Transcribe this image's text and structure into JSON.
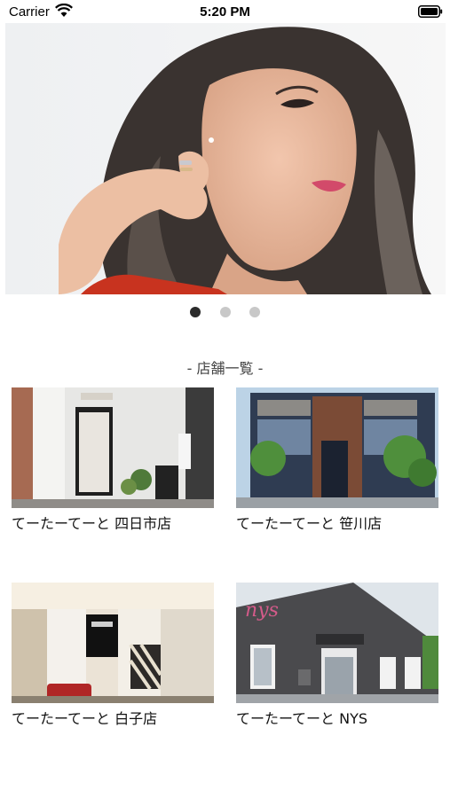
{
  "status_bar": {
    "carrier": "Carrier",
    "time": "5:20 PM",
    "wifi_icon": "wifi-icon",
    "battery_icon": "battery-icon"
  },
  "hero": {
    "image": "model-portrait-photo",
    "page_count": 3,
    "current_page": 1
  },
  "section_title": "- 店舗一覧 -",
  "shops": [
    {
      "name": "てーたーてーと 四日市店",
      "image": "yokkaichi-storefront-photo"
    },
    {
      "name": "てーたーてーと 笹川店",
      "image": "sasagawa-storefront-photo"
    },
    {
      "name": "てーたーてーと 白子店",
      "image": "shiroko-interior-photo"
    },
    {
      "name": "てーたーてーと NYS",
      "image": "nys-storefront-photo"
    }
  ],
  "colors": {
    "dot_active": "#2b2b2b",
    "dot_inactive": "#c8c8c8",
    "text": "#111111"
  }
}
